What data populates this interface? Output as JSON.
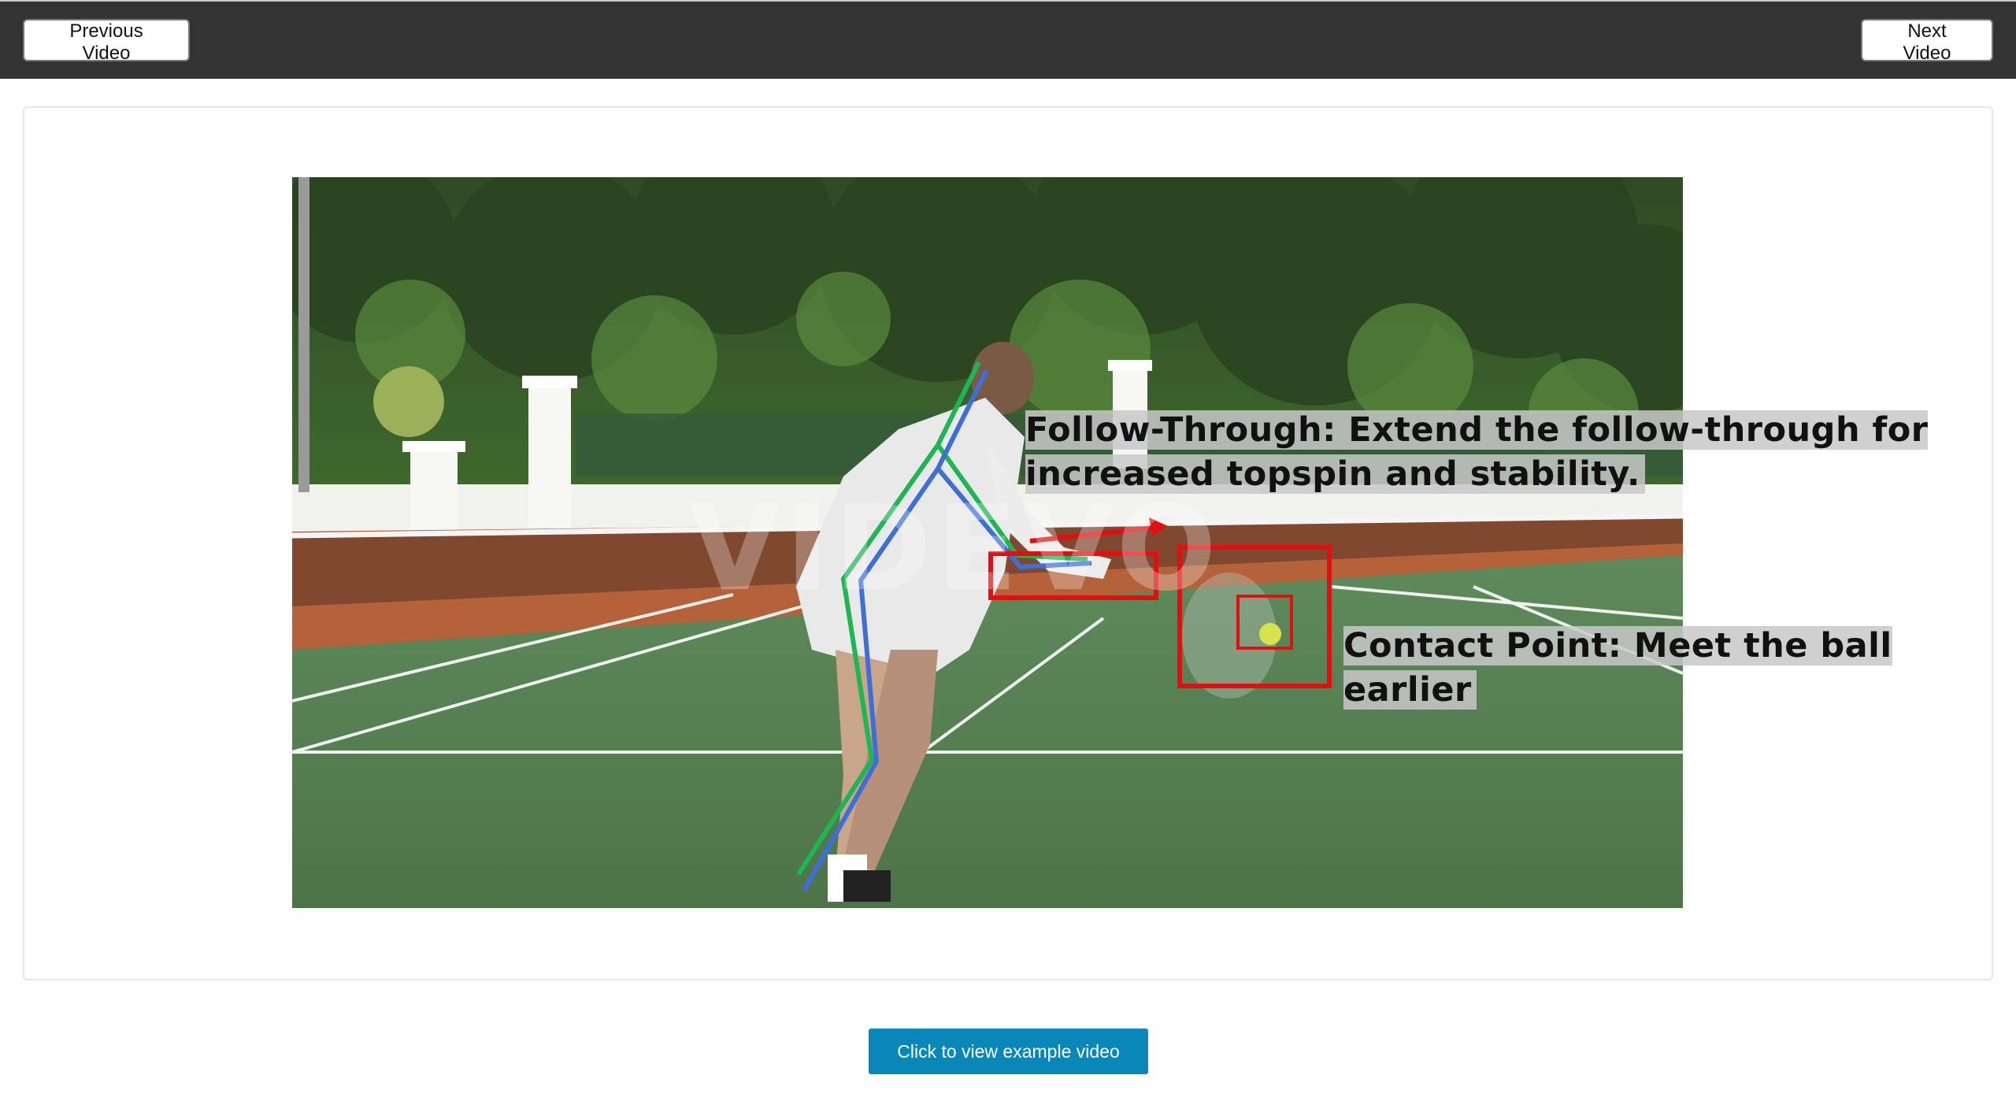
{
  "nav": {
    "prev_label": "Previous Video",
    "next_label": "Next Video"
  },
  "video": {
    "watermark_text": "VIDEVO",
    "annotations": {
      "follow_through": "Follow-Through: Extend the follow-through for increased topspin and stability.",
      "contact_point": "Contact Point: Meet the ball earlier"
    },
    "overlay_colors": {
      "skeleton_green": "#1eb553",
      "skeleton_blue": "#3f6fd6",
      "highlight_box": "#e01010",
      "arrow": "#e01010"
    }
  },
  "cta": {
    "label": "Click to view example video"
  }
}
